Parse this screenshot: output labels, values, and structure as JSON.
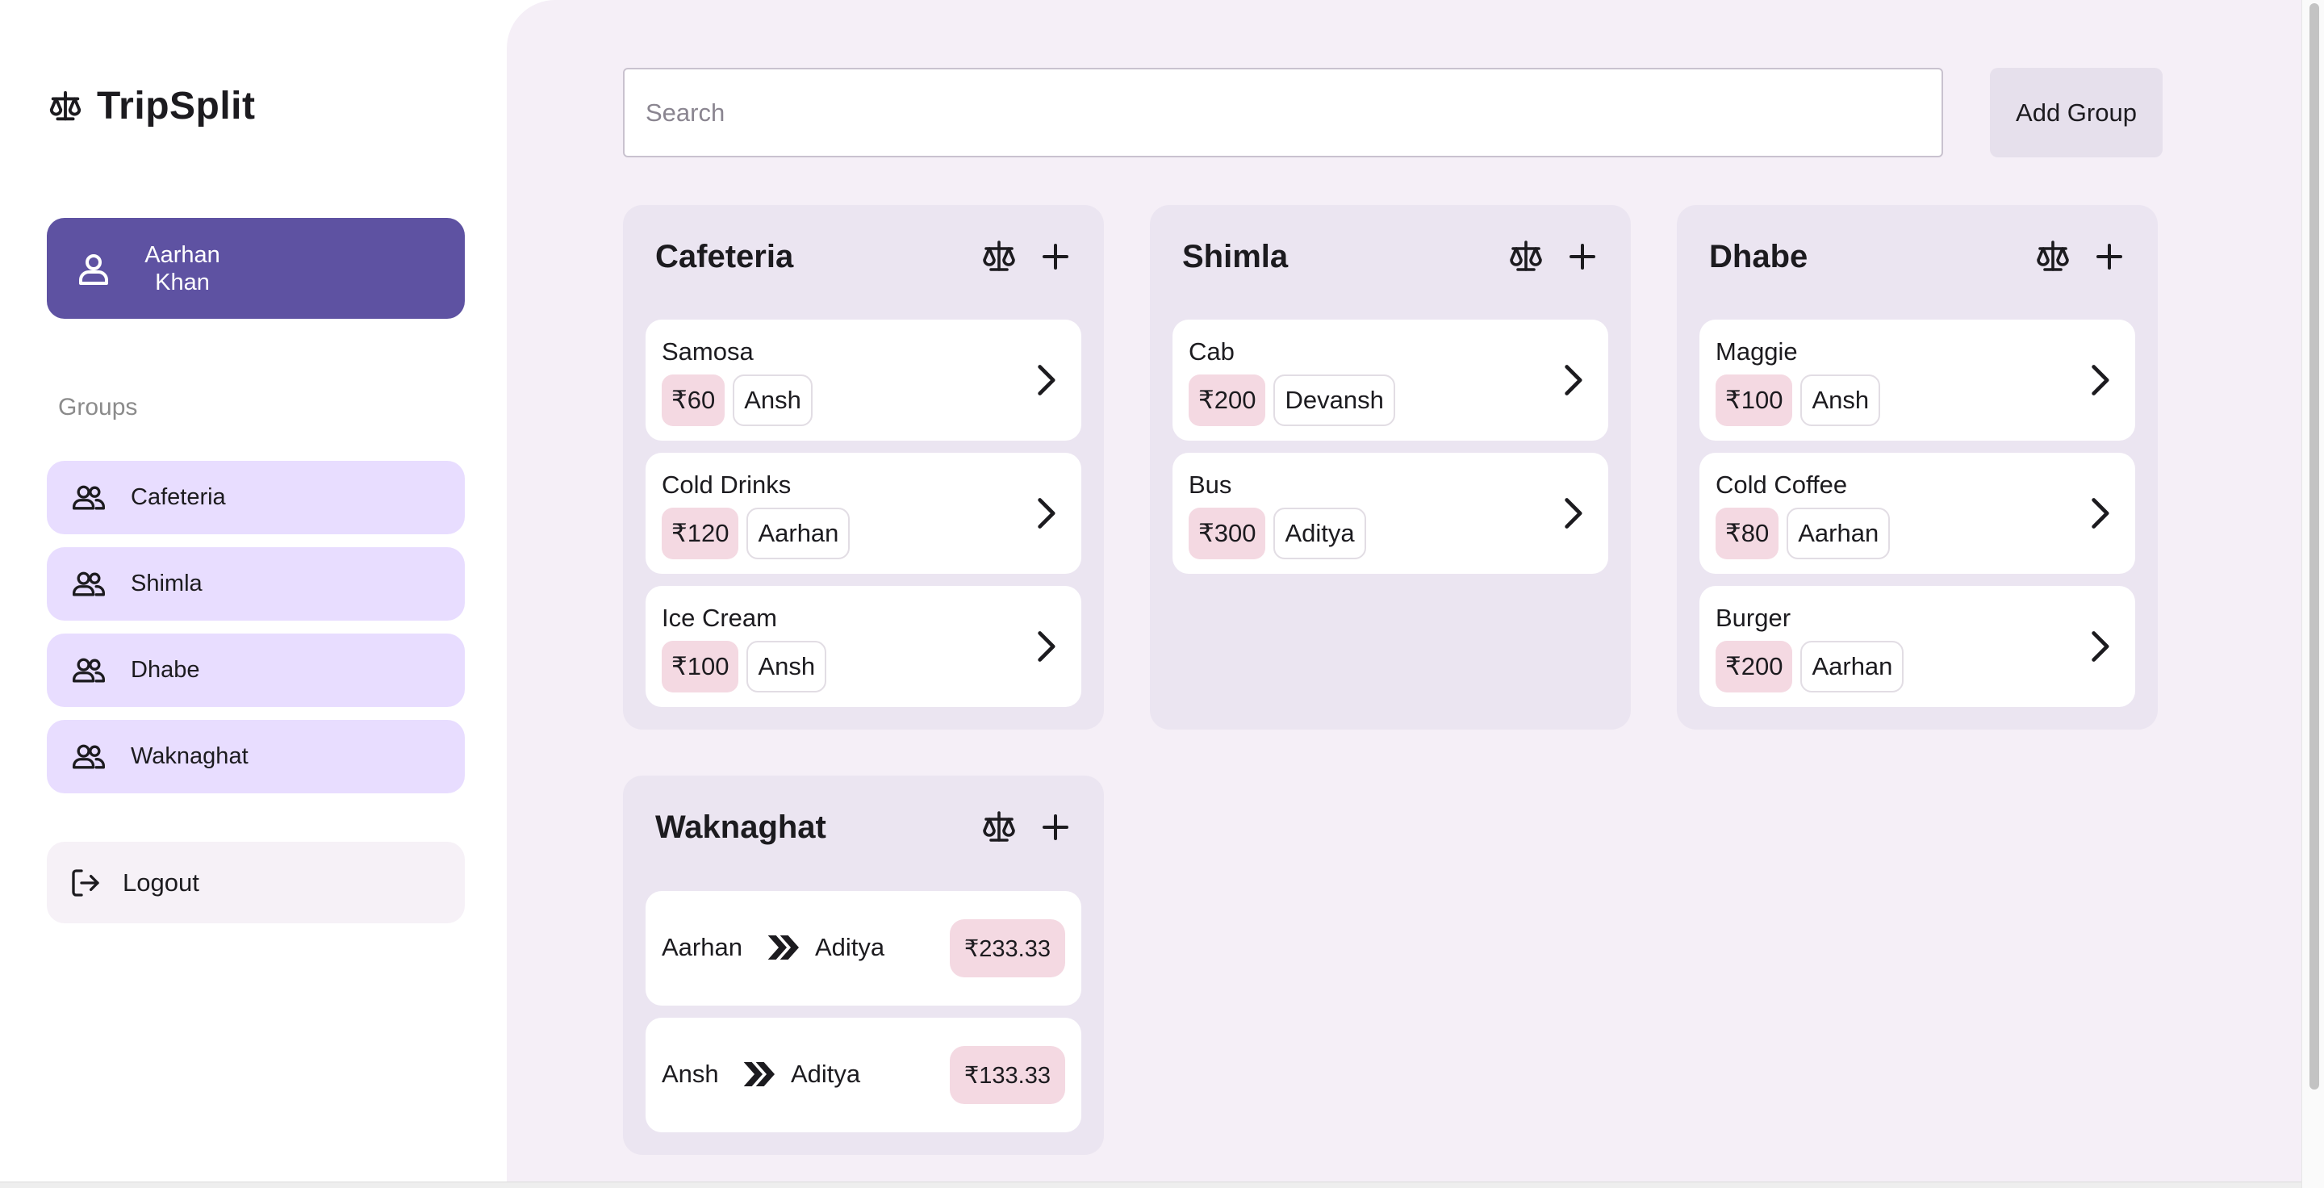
{
  "app": {
    "name": "TripSplit",
    "logo_icon": "scale-icon",
    "accent": "#5e52a2"
  },
  "user": {
    "name": "Aarhan Khan",
    "icon": "person-icon"
  },
  "sidebar": {
    "groups_label": "Groups",
    "items": [
      {
        "label": "Cafeteria",
        "icon": "group-icon"
      },
      {
        "label": "Shimla",
        "icon": "group-icon"
      },
      {
        "label": "Dhabe",
        "icon": "group-icon"
      },
      {
        "label": "Waknaghat",
        "icon": "group-icon"
      }
    ],
    "logout_label": "Logout"
  },
  "toolbar": {
    "search_placeholder": "Search",
    "add_group_label": "Add Group"
  },
  "groups": [
    {
      "title": "Cafeteria",
      "expenses": [
        {
          "name": "Samosa",
          "amount": "₹60",
          "payer": "Ansh"
        },
        {
          "name": "Cold Drinks",
          "amount": "₹120",
          "payer": "Aarhan"
        },
        {
          "name": "Ice Cream",
          "amount": "₹100",
          "payer": "Ansh"
        }
      ]
    },
    {
      "title": "Shimla",
      "expenses": [
        {
          "name": "Cab",
          "amount": "₹200",
          "payer": "Devansh"
        },
        {
          "name": "Bus",
          "amount": "₹300",
          "payer": "Aditya"
        }
      ]
    },
    {
      "title": "Dhabe",
      "expenses": [
        {
          "name": "Maggie",
          "amount": "₹100",
          "payer": "Ansh"
        },
        {
          "name": "Cold Coffee",
          "amount": "₹80",
          "payer": "Aarhan"
        },
        {
          "name": "Burger",
          "amount": "₹200",
          "payer": "Aarhan"
        }
      ]
    },
    {
      "title": "Waknaghat",
      "settlements": [
        {
          "from": "Aarhan",
          "to": "Aditya",
          "amount": "₹233.33"
        },
        {
          "from": "Ansh",
          "to": "Aditya",
          "amount": "₹133.33"
        }
      ]
    }
  ]
}
